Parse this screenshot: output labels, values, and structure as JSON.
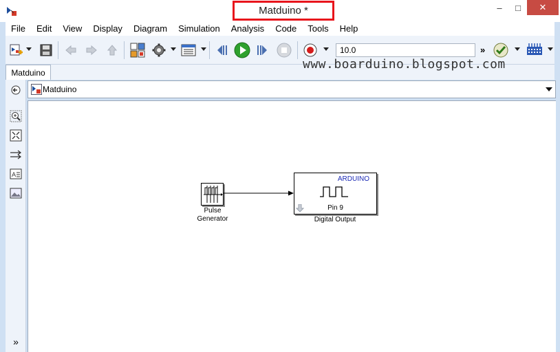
{
  "window": {
    "title": "Matduino *",
    "min": "–",
    "max": "□",
    "close": "✕"
  },
  "menu": [
    "File",
    "Edit",
    "View",
    "Display",
    "Diagram",
    "Simulation",
    "Analysis",
    "Code",
    "Tools",
    "Help"
  ],
  "toolbar": {
    "stop_time": "10.0",
    "overflow": "»"
  },
  "tab": {
    "label": "Matduino"
  },
  "watermark": "www.boarduino.blogspot.com",
  "breadcrumb": {
    "label": "Matduino"
  },
  "blocks": {
    "pulse": {
      "label_line1": "Pulse",
      "label_line2": "Generator"
    },
    "digital_output": {
      "brand": "ARDUINO",
      "pin": "Pin 9",
      "label": "Digital Output"
    }
  },
  "palette": {
    "expand": "»"
  },
  "colors": {
    "title_highlight": "#e8141b",
    "close": "#c74b43",
    "run": "#2ea12e",
    "arduino_text": "#1b2ab5"
  }
}
